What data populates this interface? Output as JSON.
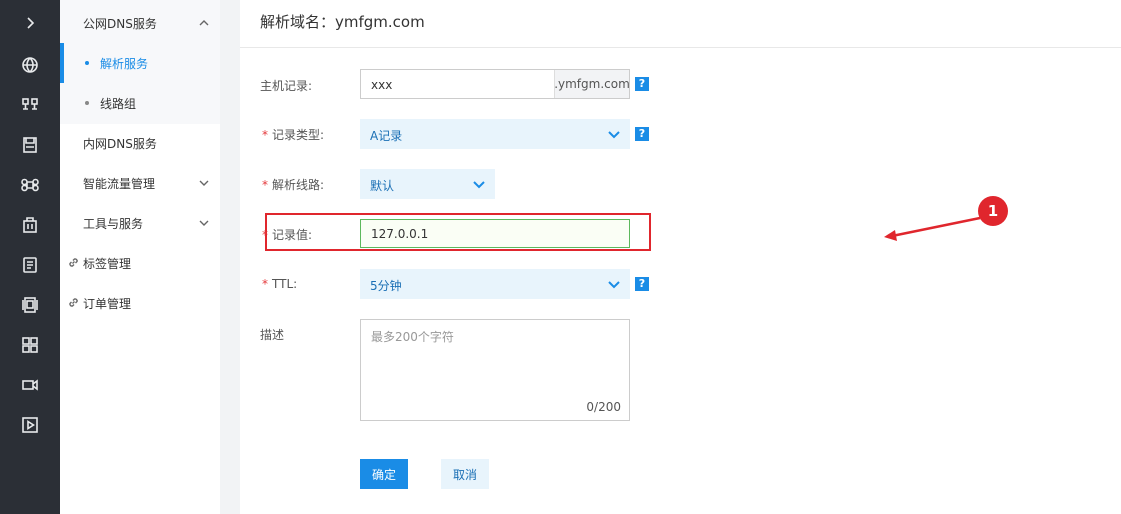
{
  "sidebar_rail": {
    "icons": [
      "chevron-right-icon",
      "globe-icon",
      "network-icon",
      "save-icon",
      "command-icon",
      "building-icon",
      "document-icon",
      "device-icon",
      "dashboard-icon",
      "video-icon",
      "play-icon"
    ]
  },
  "menu": {
    "group_public_dns": "公网DNS服务",
    "item_resolve": "解析服务",
    "item_line_group": "线路组",
    "item_private_dns": "内网DNS服务",
    "item_traffic": "智能流量管理",
    "item_tools": "工具与服务",
    "item_tags": "标签管理",
    "item_orders": "订单管理"
  },
  "page": {
    "title": "解析域名：ymfgm.com"
  },
  "form": {
    "host_record_label": "主机记录:",
    "host_record_value": "xxx",
    "host_record_suffix": ".ymfgm.com",
    "record_type_label": "记录类型:",
    "record_type_value": "A记录",
    "line_label": "解析线路:",
    "line_value": "默认",
    "record_value_label": "记录值:",
    "record_value_value": "127.0.0.1",
    "ttl_label": "TTL:",
    "ttl_value": "5分钟",
    "desc_label": "描述",
    "desc_placeholder": "最多200个字符",
    "desc_count": "0/200",
    "required_mark": "*",
    "help_glyph": "?"
  },
  "buttons": {
    "confirm": "确定",
    "cancel": "取消"
  },
  "annotation": {
    "number": "1",
    "color": "#e0262d"
  },
  "colors": {
    "accent": "#1a8ce6",
    "rail": "#2b2f36"
  }
}
